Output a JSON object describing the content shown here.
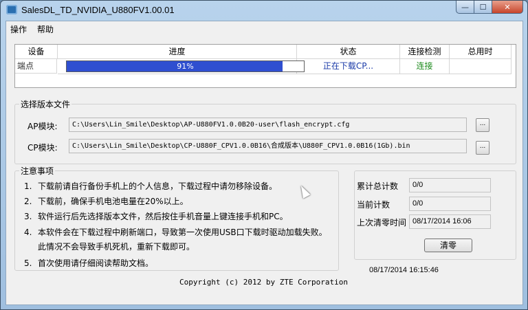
{
  "window": {
    "title": "SalesDL_TD_NVIDIA_U880FV1.00.01",
    "min_glyph": "—",
    "max_glyph": "☐",
    "close_glyph": "✕"
  },
  "menu": [
    "操作",
    "帮助"
  ],
  "grid": {
    "headers": [
      "设备",
      "进度",
      "状态",
      "连接检测",
      "总用时"
    ],
    "row": {
      "device": "端点",
      "progress": 91,
      "progress_text": "91%",
      "status": "正在下载CP...",
      "connection": "连接",
      "total_time": ""
    }
  },
  "version": {
    "title": "选择版本文件",
    "ap_label": "AP模块:",
    "ap_path": "C:\\Users\\Lin_Smile\\Desktop\\AP-U880FV1.0.0B20-user\\flash_encrypt.cfg",
    "cp_label": "CP模块:",
    "cp_path": "C:\\Users\\Lin_Smile\\Desktop\\CP-U880F_CPV1.0.0B16\\合成版本\\U880F_CPV1.0.0B16(1Gb).bin",
    "browse": "..."
  },
  "notes": {
    "title": "注意事项",
    "items": [
      {
        "n": "1.",
        "text": "下载前请自行备份手机上的个人信息，下载过程中请勿移除设备。"
      },
      {
        "n": "2.",
        "text": "下载前，确保手机电池电量在20%以上。"
      },
      {
        "n": "3.",
        "text": "软件运行后先选择版本文件，然后按住手机音量上键连接手机和PC。"
      },
      {
        "n": "4.",
        "text": "本软件会在下载过程中刷新端口，导致第一次使用USB口下载时驱动加载失败。"
      },
      {
        "n": "",
        "text": "此情况不会导致手机死机，重新下载即可。"
      },
      {
        "n": "5.",
        "text": "首次使用请仔细阅读帮助文档。"
      }
    ]
  },
  "stats": {
    "total_label": "累计总计数",
    "total_value": "0/0",
    "current_label": "当前计数",
    "current_value": "0/0",
    "last_clear_label": "上次清零时间",
    "last_clear_value": "08/17/2014 16:06",
    "clear_button": "清零"
  },
  "footer": {
    "copyright": "Copyright (c) 2012 by ZTE Corporation",
    "datetime": "08/17/2014 16:15:46"
  },
  "colors": {
    "progress": "#2f4fd0",
    "status_text": "#1a3aa8",
    "connection_text": "#1c8a1c",
    "titlebar": "#b8d3ec"
  }
}
